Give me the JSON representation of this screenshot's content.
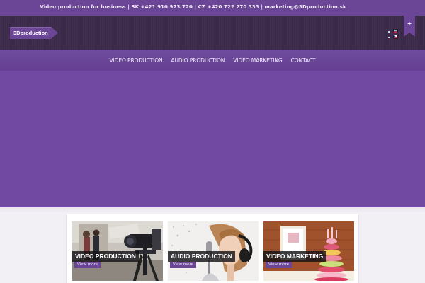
{
  "topbar": {
    "text": "Video production for business | SK +421 910 973 720 | CZ +420 722 270 333 | marketing@3Dproduction.sk"
  },
  "header": {
    "logo_text": "3Dproduction",
    "languages": [
      {
        "code": "sk",
        "icon": "flag-sk-icon"
      },
      {
        "code": "cz",
        "icon": "flag-cz-icon"
      }
    ],
    "ribbon_icon": "plus-icon",
    "ribbon_symbol": "+"
  },
  "nav": {
    "items": [
      {
        "label": "VIDEO PRODUCTION"
      },
      {
        "label": "AUDIO PRODUCTION"
      },
      {
        "label": "VIDEO MARKETING"
      },
      {
        "label": "CONTACT"
      }
    ]
  },
  "services": [
    {
      "title": "VIDEO PRODUCTION",
      "button": "View more",
      "image": "camera-crew-photo"
    },
    {
      "title": "AUDIO PRODUCTION",
      "button": "View more",
      "image": "singer-headphones-photo"
    },
    {
      "title": "VIDEO MARKETING",
      "button": "View more",
      "image": "macaron-tower-photo"
    }
  ],
  "colors": {
    "brand_purple": "#6b4596",
    "hero_purple": "#7149a2",
    "header_dark": "#3b2a49"
  }
}
